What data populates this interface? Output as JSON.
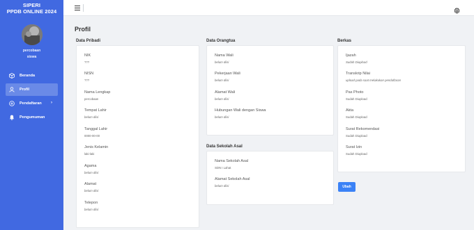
{
  "sidebar": {
    "brand_line1": "SIPERI",
    "brand_line2": "PPDB ONLINE 2024",
    "user_line1": "percobaan",
    "user_line2": "siswa",
    "items": [
      {
        "label": "Beranda",
        "icon": "cube-icon"
      },
      {
        "label": "Profil",
        "icon": "user-icon"
      },
      {
        "label": "Pendaftaran",
        "icon": "plus-circle-icon"
      },
      {
        "label": "Pengumuman",
        "icon": "bell-icon"
      }
    ]
  },
  "page_title": "Profil",
  "sections": {
    "pribadi": {
      "title": "Data Pribadi",
      "fields": [
        {
          "label": "NIK",
          "value": "???"
        },
        {
          "label": "NISN",
          "value": "???"
        },
        {
          "label": "Nama Lengkap",
          "value": "percobaan"
        },
        {
          "label": "Tempat Lahir",
          "value": "belum diisi"
        },
        {
          "label": "Tanggal Lahir",
          "value": "0000-00-00"
        },
        {
          "label": "Jenis Kelamin",
          "value": "laki-laki"
        },
        {
          "label": "Agama",
          "value": "belum diisi"
        },
        {
          "label": "Alamat",
          "value": "belum diisi"
        },
        {
          "label": "Telepon",
          "value": "belum diisi"
        }
      ]
    },
    "orangtua": {
      "title": "Data Orangtua",
      "fields": [
        {
          "label": "Nama Wali",
          "value": "belum diisi"
        },
        {
          "label": "Pekerjaan Wali",
          "value": "belum diisi"
        },
        {
          "label": "Alamat Wali",
          "value": "belum diisi"
        },
        {
          "label": "Hubungan Wali dengan Siswa",
          "value": "belum diisi"
        }
      ]
    },
    "sekolah": {
      "title": "Data Sekolah Asal",
      "fields": [
        {
          "label": "Nama Sekolah Asal",
          "value": "SDN I Lahat"
        },
        {
          "label": "Alamat Sekolah Asal",
          "value": "belum diisi"
        }
      ]
    },
    "berkas": {
      "title": "Berkas",
      "fields": [
        {
          "label": "Ijazah",
          "value": "Sudah Diupload"
        },
        {
          "label": "Transkrip Nilai",
          "value": "upload pada saat melakukan pendaftaran"
        },
        {
          "label": "Pas Photo",
          "value": "Sudah Diupload"
        },
        {
          "label": "Akta",
          "value": "Sudah Diupload"
        },
        {
          "label": "Surat Rekomendasi",
          "value": "Sudah Diupload"
        },
        {
          "label": "Surat Izin",
          "value": "Sudah Diupload"
        }
      ]
    }
  },
  "button_label": "Ubah",
  "colors": {
    "sidebar": "#4169e1",
    "button": "#3b82f6"
  }
}
